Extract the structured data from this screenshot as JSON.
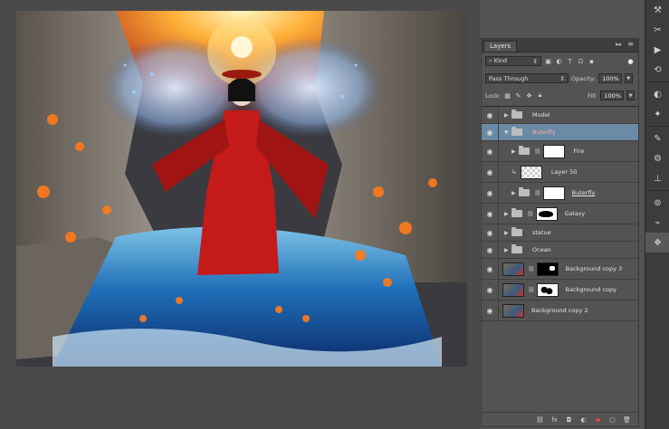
{
  "panel": {
    "tab": "Layers",
    "double_arrow": "▸▸",
    "menu": "≡",
    "filter": {
      "label": "Kind",
      "icons": [
        "▣",
        "◐",
        "T",
        "⊡",
        "▪"
      ]
    },
    "blend_mode": "Pass Through",
    "opacity_label": "Opacity:",
    "opacity": "100%",
    "lock_label": "Lock:",
    "fill_label": "Fill:",
    "fill": "100%",
    "layers": [
      {
        "name": "Model"
      },
      {
        "name": "Buterfly"
      },
      {
        "name": "Fire"
      },
      {
        "name": "Layer 50"
      },
      {
        "name": "Buterfly"
      },
      {
        "name": "Galaxy"
      },
      {
        "name": "statue"
      },
      {
        "name": "Ocean"
      },
      {
        "name": "Background copy 3"
      },
      {
        "name": "Background copy"
      },
      {
        "name": "Background copy 2"
      }
    ]
  },
  "icons": {
    "eye": "eye-icon",
    "folder": "folder-icon",
    "chain": "link-icon",
    "footer": [
      "link-icon",
      "fx-icon",
      "mask-icon",
      "adjustment-icon",
      "new-group-icon",
      "new-layer-icon",
      "trash-icon"
    ]
  },
  "colors": {
    "selected_row": "#6a8aa6",
    "accent_red": "#e05050",
    "panel_bg": "#535353"
  }
}
